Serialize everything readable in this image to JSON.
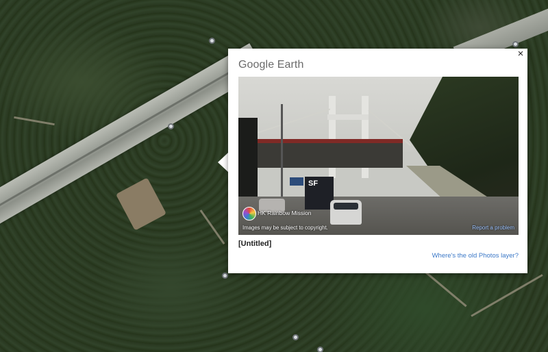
{
  "card": {
    "brand": "Google Earth",
    "close_glyph": "×",
    "photo": {
      "owner_name": "HK Rainbow Mission",
      "copyright": "Images may be subject to copyright.",
      "report_link": "Report a problem",
      "truck_logo": "SF"
    },
    "title": "[Untitled]",
    "old_photos_link": "Where's the old Photos layer?"
  },
  "icons": {
    "close": "close-icon",
    "owner_avatar": "rainbow-avatar",
    "map_pins": "photo-pin-icon"
  },
  "colors": {
    "link": "#3b78c7",
    "report_link": "#9ec4ff",
    "card_bg": "#ffffff"
  }
}
